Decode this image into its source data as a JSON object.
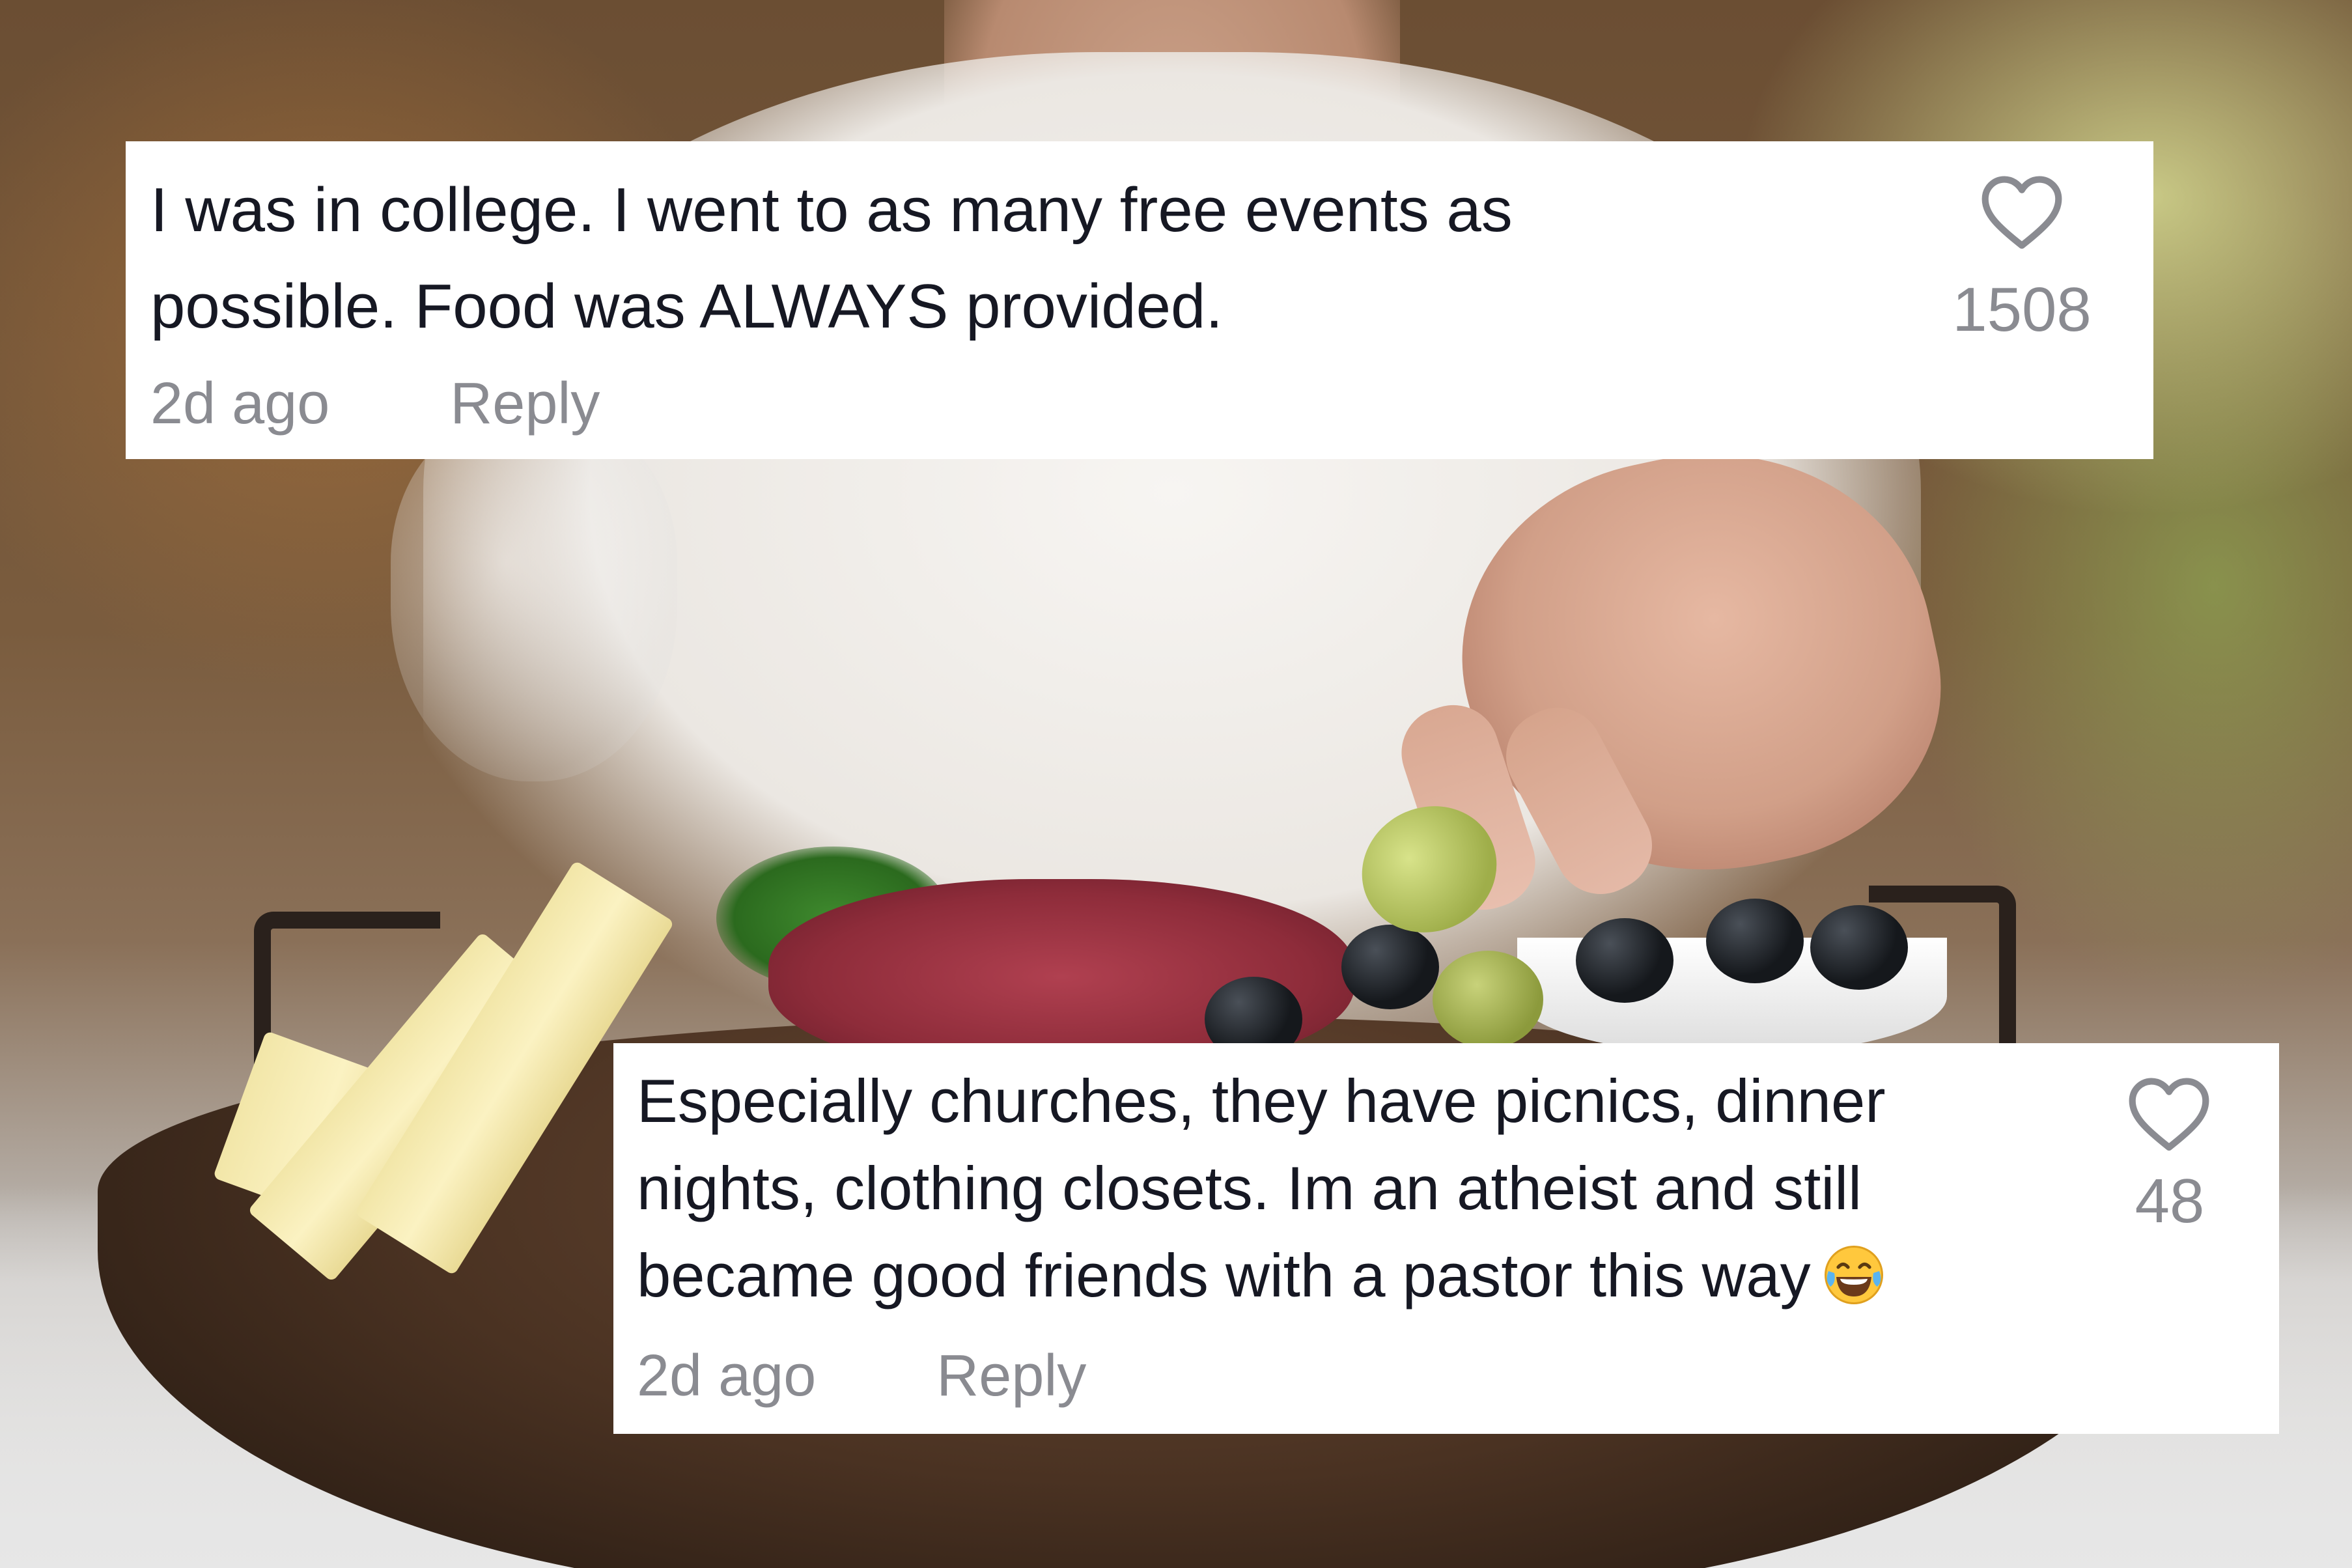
{
  "comments": [
    {
      "text_lines": [
        "I was in college. I went to as many free events as",
        "possible. Food was ALWAYS provided."
      ],
      "timestamp": "2d ago",
      "reply_label": "Reply",
      "like_count": "1508",
      "like_icon": "heart-outline-icon"
    },
    {
      "text_lines": [
        "Especially churches, they have picnics, dinner",
        "nights, clothing closets. Im an atheist and still",
        "became good friends with a pastor this way"
      ],
      "emoji": "face-with-tears-of-joy-icon",
      "timestamp": "2d ago",
      "reply_label": "Reply",
      "like_count": "48",
      "like_icon": "heart-outline-icon"
    }
  ],
  "colors": {
    "card_background": "#ffffff",
    "comment_text": "#161823",
    "meta_text": "#8a8b91",
    "emoji_yellow": "#ffc83d"
  }
}
